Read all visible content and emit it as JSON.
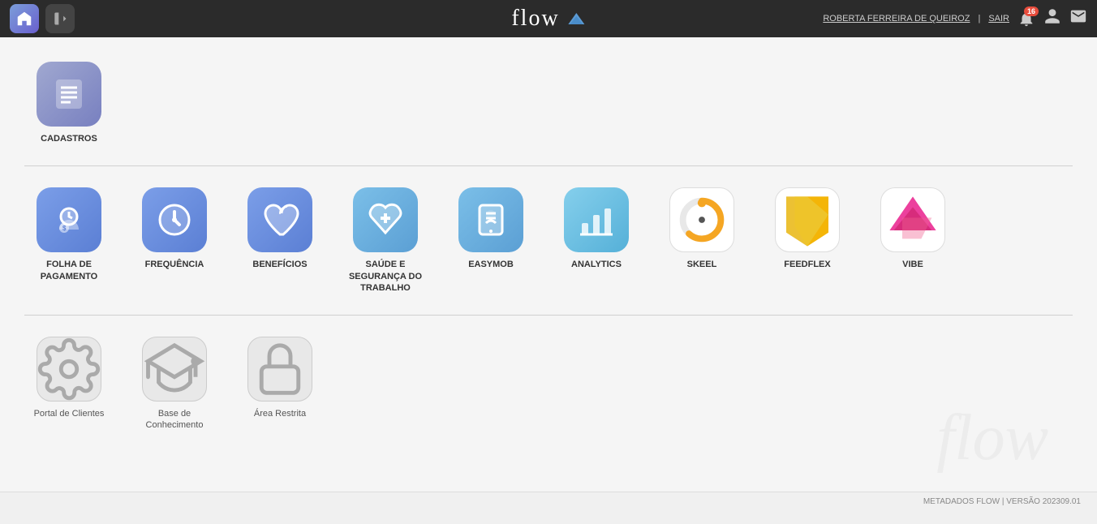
{
  "header": {
    "logo_text": "flow",
    "user_name": "ROBERTA FERREIRA DE QUEIROZ",
    "separator": "|",
    "sair": "SAIR",
    "notif_count": "16"
  },
  "sections": [
    {
      "id": "cadastros",
      "apps": [
        {
          "id": "cadastros",
          "label": "CADASTROS",
          "icon_type": "cadastros",
          "normal_label": false
        }
      ]
    },
    {
      "id": "modules",
      "apps": [
        {
          "id": "folha",
          "label": "FOLHA DE\nPAGAMENTO",
          "icon_type": "folha",
          "normal_label": false
        },
        {
          "id": "frequencia",
          "label": "FREQUÊNCIA",
          "icon_type": "freq",
          "normal_label": false
        },
        {
          "id": "beneficios",
          "label": "BENEFÍCIOS",
          "icon_type": "benef",
          "normal_label": false
        },
        {
          "id": "saude",
          "label": "SAÚDE E\nSEGURANÇA DO\nTRABALHO",
          "icon_type": "saude",
          "normal_label": false
        },
        {
          "id": "easymob",
          "label": "EASYMOB",
          "icon_type": "easymob",
          "normal_label": false
        },
        {
          "id": "analytics",
          "label": "ANALYTICS",
          "icon_type": "analytics",
          "normal_label": false
        },
        {
          "id": "skeel",
          "label": "SKEEL",
          "icon_type": "skeel",
          "normal_label": false
        },
        {
          "id": "feedflex",
          "label": "FEEDFLEX",
          "icon_type": "feedflex",
          "normal_label": false
        },
        {
          "id": "vibe",
          "label": "VIBE",
          "icon_type": "vibe",
          "normal_label": false
        }
      ]
    },
    {
      "id": "portals",
      "apps": [
        {
          "id": "portal",
          "label": "Portal de Clientes",
          "icon_type": "gray-gear",
          "normal_label": true
        },
        {
          "id": "base",
          "label": "Base de\nConhecimento",
          "icon_type": "gray-cap",
          "normal_label": true
        },
        {
          "id": "restrita",
          "label": "Área Restrita",
          "icon_type": "gray-lock",
          "normal_label": true
        }
      ]
    }
  ],
  "footer": {
    "text": "METADADOS FLOW | VERSÃO 202309.01"
  }
}
